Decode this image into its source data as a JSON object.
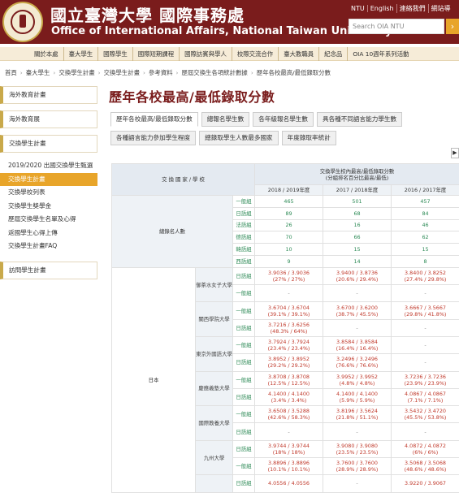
{
  "header": {
    "title_zh": "國立臺灣大學 國際事務處",
    "title_en": "Office of International Affairs, National Taiwan University",
    "top_links": [
      "NTU",
      "English",
      "連絡我們",
      "網站導"
    ],
    "search_placeholder": "Search OIA NTU",
    "search_icon": "chevron-right-icon",
    "brand_color": "#7a1c1c",
    "accent_color": "#e8a52a"
  },
  "main_nav": {
    "items": [
      "關於本處",
      "臺大學生",
      "國際學生",
      "國際短期課程",
      "國際訪賓與學人",
      "校際交流合作",
      "臺大教職員",
      "紀念品",
      "OIA 10週年系列活動"
    ]
  },
  "breadcrumb": [
    "首頁",
    "臺大學生",
    "交換學生計畫",
    "交換學生計畫",
    "參考資料",
    "歷屆交換生各項統計數據",
    "歷年各校最高/最低錄取分數"
  ],
  "sidebar": {
    "blocks": [
      "海外教育計畫",
      "海外教育展",
      "交換學生計畫"
    ],
    "items": [
      "2019/2020 出國交換學生甄選",
      "交換學生計畫",
      "交換學校列表",
      "交換學生獎學金",
      "歷屆交換學生名單及心得",
      "返國學生心得上傳",
      "交換學生計畫FAQ"
    ],
    "active_index": 1,
    "bottom_block": "訪問學生計畫"
  },
  "page": {
    "title": "歷年各校最高/最低錄取分數",
    "tabs_row1": [
      "歷年各校最高/最低錄取分數",
      "總報名學生數",
      "各年級報名學生數",
      "具各種不同語言能力學生數"
    ],
    "tabs_row2": [
      "各種語言能力參加學生程度",
      "總錄取學生人數最多國家",
      "年度錄取率統計"
    ],
    "active_tab": 0,
    "tab_arrow": "▶"
  },
  "table": {
    "col_header": "交 換 國 家 / 學 校",
    "score_header": "交換學生校內最高/最低錄取分數",
    "score_subheader": "(分組排名百分比最高/最低)",
    "years": [
      "2018 / 2019年度",
      "2017 / 2018年度",
      "2016 / 2017年度"
    ],
    "total_label": "總錄名人數",
    "totals": [
      {
        "group": "一般組",
        "values": [
          "465",
          "501",
          "457"
        ]
      },
      {
        "group": "日語組",
        "values": [
          "89",
          "68",
          "84"
        ]
      },
      {
        "group": "法語組",
        "values": [
          "26",
          "16",
          "46"
        ]
      },
      {
        "group": "德語組",
        "values": [
          "70",
          "66",
          "62"
        ]
      },
      {
        "group": "韓語組",
        "values": [
          "10",
          "15",
          "15"
        ]
      },
      {
        "group": "西語組",
        "values": [
          "9",
          "14",
          "8"
        ]
      }
    ],
    "country": "日本",
    "universities": [
      {
        "name": "御茶水女子大學",
        "rows": [
          {
            "group": "日語組",
            "values": [
              [
                "3.9036 / 3.9036",
                "(27% / 27%)"
              ],
              [
                "3.9400 / 3.8736",
                "(20.6% / 29.4%)"
              ],
              [
                "3.8400 / 3.8252",
                "(27.4% / 29.8%)"
              ]
            ]
          },
          {
            "group": "一般組",
            "values": [
              [
                "-",
                ""
              ],
              [
                "-",
                ""
              ],
              [
                "-",
                ""
              ]
            ]
          }
        ]
      },
      {
        "name": "關西學院大學",
        "rows": [
          {
            "group": "一般組",
            "values": [
              [
                "3.6704 / 3.6704",
                "(39.1% / 39.1%)"
              ],
              [
                "3.6700 / 3.6200",
                "(38.7% / 45.5%)"
              ],
              [
                "3.6667 / 3.5667",
                "(29.8% / 41.8%)"
              ]
            ]
          },
          {
            "group": "日語組",
            "values": [
              [
                "3.7216 / 3.6256",
                "(48.3% / 64%)"
              ],
              [
                "-",
                ""
              ],
              [
                "-",
                ""
              ]
            ]
          }
        ]
      },
      {
        "name": "東京外國語大學",
        "rows": [
          {
            "group": "一般組",
            "values": [
              [
                "3.7924 / 3.7924",
                "(23.4% / 23.4%)"
              ],
              [
                "3.8584 / 3.8584",
                "(16.4% / 16.4%)"
              ],
              [
                "-",
                ""
              ]
            ]
          },
          {
            "group": "日語組",
            "values": [
              [
                "3.8952 / 3.8952",
                "(29.2% / 29.2%)"
              ],
              [
                "3.2496 / 3.2496",
                "(76.6% / 76.6%)"
              ],
              [
                "-",
                ""
              ]
            ]
          }
        ]
      },
      {
        "name": "慶應義塾大學",
        "rows": [
          {
            "group": "一般組",
            "values": [
              [
                "3.8708 / 3.8708",
                "(12.5% / 12.5%)"
              ],
              [
                "3.9952 / 3.9952",
                "(4.8% / 4.8%)"
              ],
              [
                "3.7236 / 3.7236",
                "(23.9% / 23.9%)"
              ]
            ]
          },
          {
            "group": "日語組",
            "values": [
              [
                "4.1400 / 4.1400",
                "(3.4% / 3.4%)"
              ],
              [
                "4.1400 / 4.1400",
                "(5.9% / 5.9%)"
              ],
              [
                "4.0867 / 4.0867",
                "(7.1% / 7.1%)"
              ]
            ]
          }
        ]
      },
      {
        "name": "國際教養大學",
        "rows": [
          {
            "group": "一般組",
            "values": [
              [
                "3.6508 / 3.5288",
                "(42.6% / 58.3%)"
              ],
              [
                "3.8196 / 3.5624",
                "(21.8% / 51.1%)"
              ],
              [
                "3.5432 / 3.4720",
                "(45.5% / 53.8%)"
              ]
            ]
          },
          {
            "group": "日語組",
            "values": [
              [
                "-",
                ""
              ],
              [
                "-",
                ""
              ],
              [
                "-",
                ""
              ]
            ]
          }
        ]
      },
      {
        "name": "九州大學",
        "rows": [
          {
            "group": "日語組",
            "values": [
              [
                "3.9744 / 3.9744",
                "(18% / 18%)"
              ],
              [
                "3.9080 / 3.9080",
                "(23.5% / 23.5%)"
              ],
              [
                "4.0872 / 4.0872",
                "(6% / 6%)"
              ]
            ]
          },
          {
            "group": "一般組",
            "values": [
              [
                "3.8896 / 3.8896",
                "(10.1% / 10.1%)"
              ],
              [
                "3.7600 / 3.7600",
                "(28.9% / 28.9%)"
              ],
              [
                "3.5068 / 3.5068",
                "(48.6% / 48.6%)"
              ]
            ]
          }
        ]
      },
      {
        "name": "",
        "rows": [
          {
            "group": "日語組",
            "values": [
              [
                "4.0556 / 4.0556",
                ""
              ],
              [
                "-",
                ""
              ],
              [
                "3.9220 / 3.9067",
                ""
              ]
            ]
          }
        ]
      }
    ]
  }
}
